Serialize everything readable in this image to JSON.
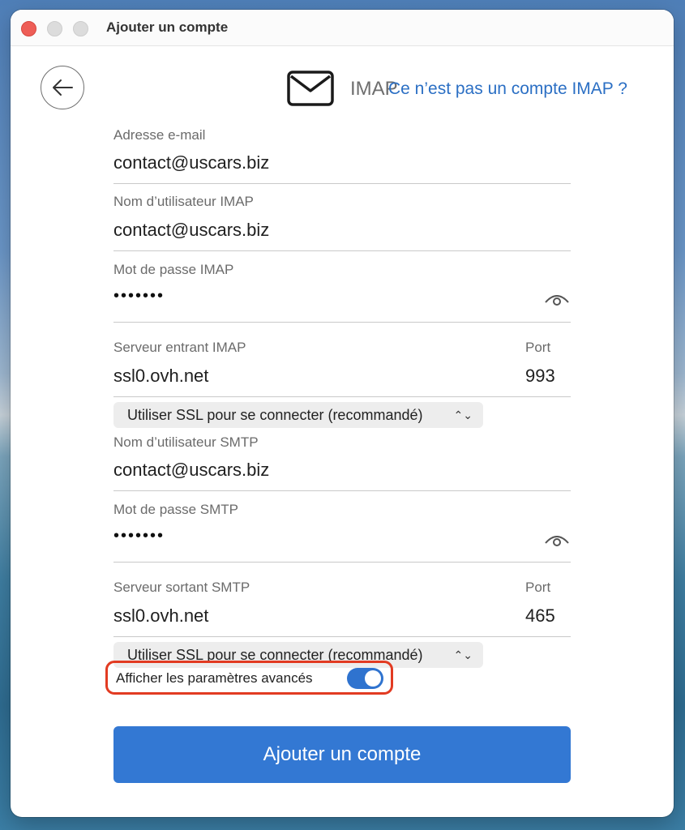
{
  "window": {
    "title": "Ajouter un compte"
  },
  "header": {
    "account_type": "IMAP",
    "not_imap_link": "Ce n’est pas un compte IMAP ?"
  },
  "form": {
    "email": {
      "label": "Adresse e-mail",
      "value": "contact@uscars.biz"
    },
    "imap_user": {
      "label": "Nom d’utilisateur IMAP",
      "value": "contact@uscars.biz"
    },
    "imap_password": {
      "label": "Mot de passe IMAP",
      "value": "•••••••"
    },
    "incoming_server": {
      "label": "Serveur entrant IMAP",
      "value": "ssl0.ovh.net",
      "port_label": "Port",
      "port_value": "993"
    },
    "incoming_ssl": {
      "selected": "Utiliser SSL pour se connecter (recommandé)"
    },
    "smtp_user": {
      "label": "Nom d’utilisateur SMTP",
      "value": "contact@uscars.biz"
    },
    "smtp_password": {
      "label": "Mot de passe SMTP",
      "value": "•••••••"
    },
    "outgoing_server": {
      "label": "Serveur sortant SMTP",
      "value": "ssl0.ovh.net",
      "port_label": "Port",
      "port_value": "465"
    },
    "outgoing_ssl": {
      "selected": "Utiliser SSL pour se connecter (recommandé)"
    },
    "advanced": {
      "label": "Afficher les paramètres avancés",
      "enabled": true
    }
  },
  "actions": {
    "submit_label": "Ajouter un compte"
  },
  "colors": {
    "accent": "#3378d3",
    "link": "#2b6fc4",
    "highlight_border": "#e23b22"
  }
}
